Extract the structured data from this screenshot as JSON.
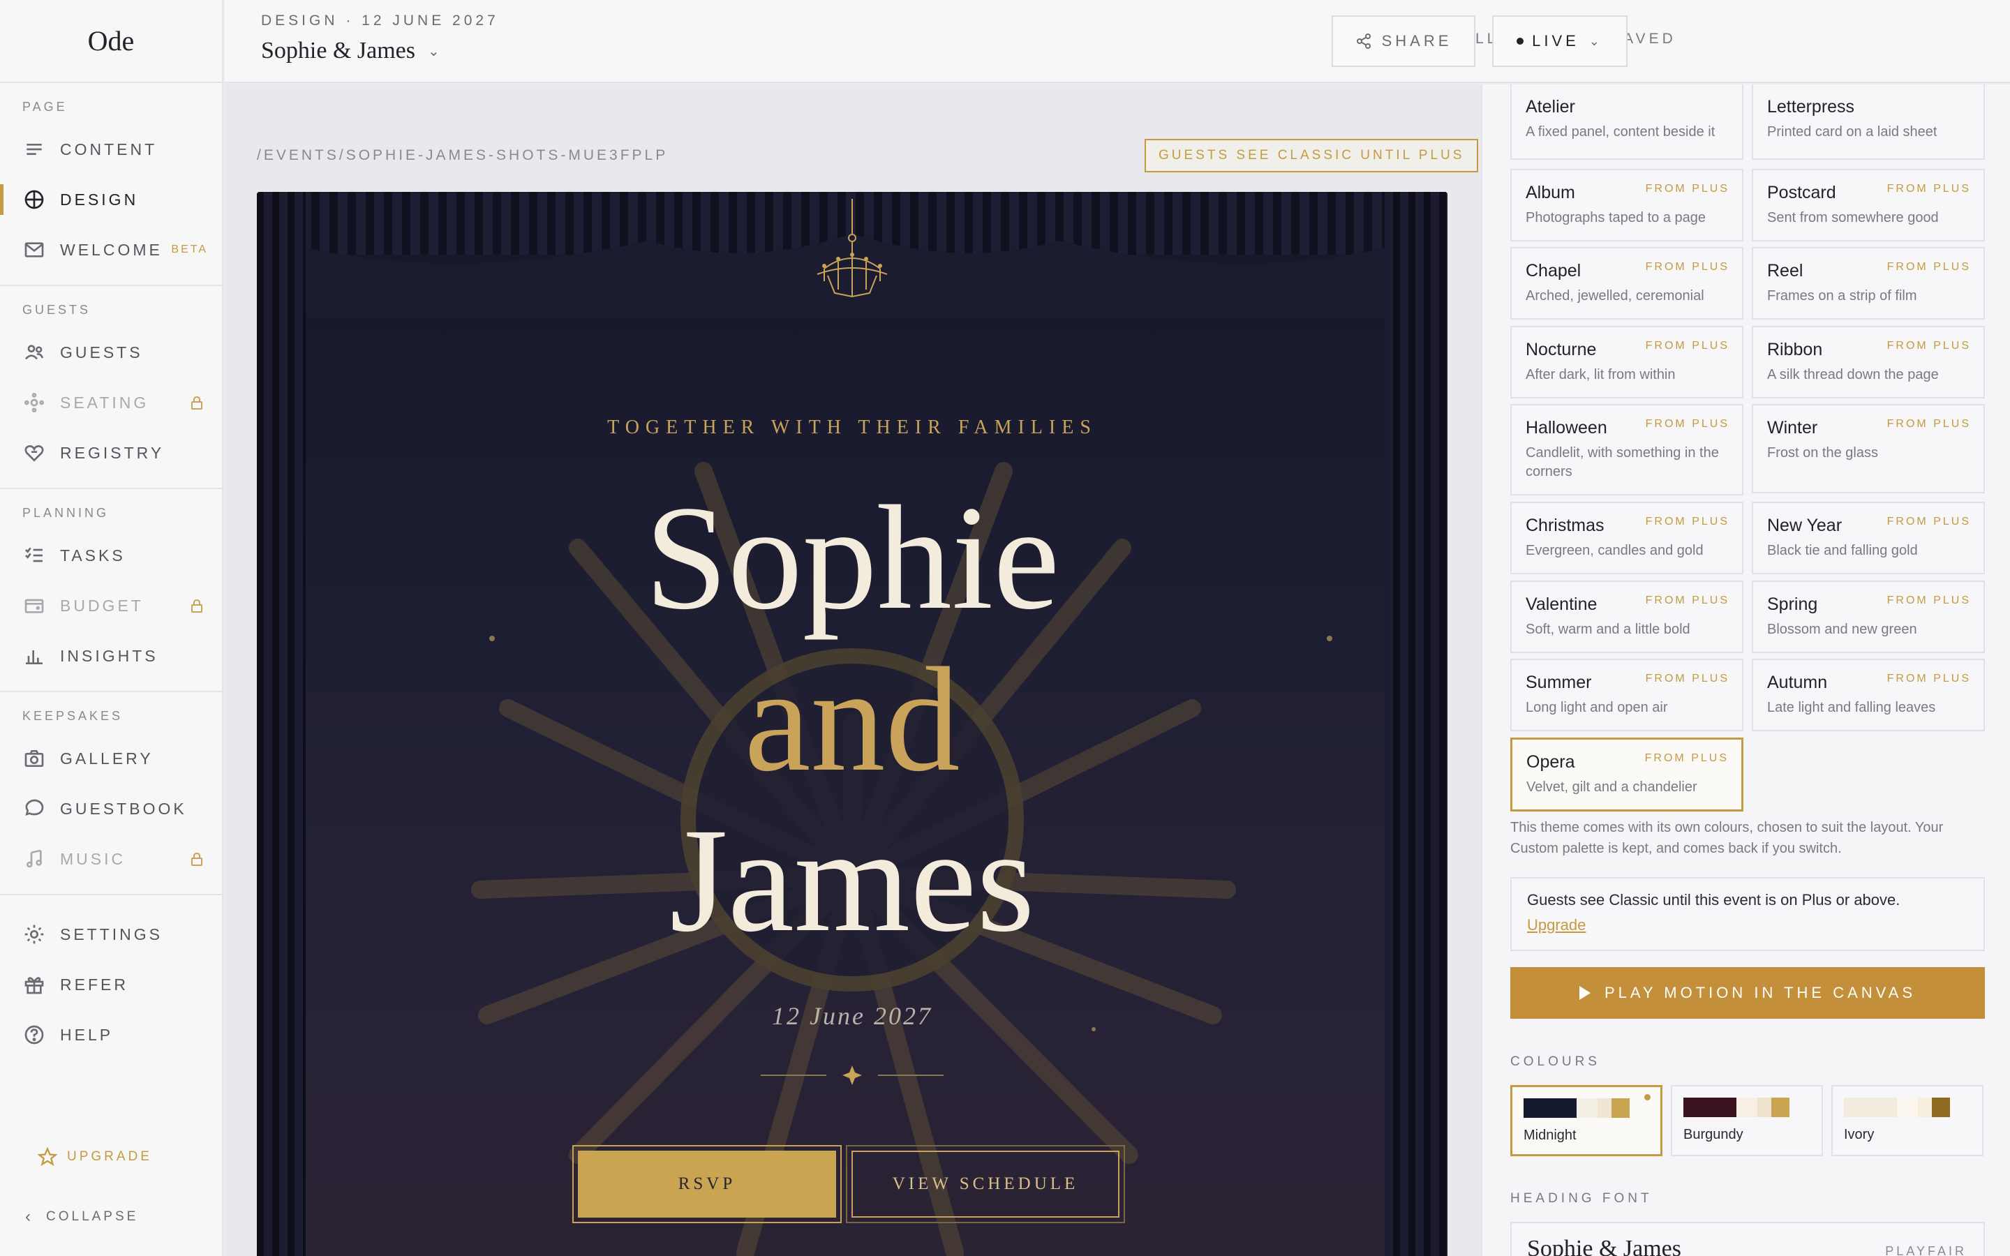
{
  "app": {
    "logo": "Ode"
  },
  "sidebar": {
    "sections": [
      {
        "label": "PAGE",
        "items": [
          {
            "label": "CONTENT",
            "icon": "lines-icon"
          },
          {
            "label": "DESIGN",
            "icon": "compass-icon",
            "active": true
          },
          {
            "label": "WELCOME",
            "icon": "mail-icon",
            "badge": "BETA"
          }
        ]
      },
      {
        "label": "GUESTS",
        "items": [
          {
            "label": "GUESTS",
            "icon": "people-icon"
          },
          {
            "label": "SEATING",
            "icon": "seating-icon",
            "locked": true
          },
          {
            "label": "REGISTRY",
            "icon": "heart-gift-icon"
          }
        ]
      },
      {
        "label": "PLANNING",
        "items": [
          {
            "label": "TASKS",
            "icon": "checklist-icon"
          },
          {
            "label": "BUDGET",
            "icon": "wallet-icon",
            "locked": true
          },
          {
            "label": "INSIGHTS",
            "icon": "bar-chart-icon"
          }
        ]
      },
      {
        "label": "KEEPSAKES",
        "items": [
          {
            "label": "GALLERY",
            "icon": "camera-icon"
          },
          {
            "label": "GUESTBOOK",
            "icon": "speech-bubble-icon"
          },
          {
            "label": "MUSIC",
            "icon": "music-note-icon",
            "locked": true
          }
        ]
      }
    ],
    "bottom_items": [
      {
        "label": "SETTINGS",
        "icon": "gear-icon"
      },
      {
        "label": "REFER",
        "icon": "gift-icon"
      },
      {
        "label": "HELP",
        "icon": "help-icon"
      }
    ],
    "upgrade": "UPGRADE",
    "collapse": "COLLAPSE"
  },
  "header": {
    "crumb": "DESIGN · 12 JUNE 2027",
    "event_title": "Sophie & James",
    "saved": "ALL CHANGES SAVED",
    "share": "SHARE",
    "live": "LIVE"
  },
  "canvas": {
    "url": "/EVENTS/SOPHIE-JAMES-SHOTS-MUE3FPLP",
    "guests_badge": "GUESTS SEE CLASSIC UNTIL PLUS",
    "preview": {
      "together": "TOGETHER WITH THEIR FAMILIES",
      "name1": "Sophie",
      "and": "and",
      "name2": "James",
      "date": "12 June 2027",
      "rsvp": "RSVP",
      "schedule": "VIEW SCHEDULE"
    }
  },
  "panel": {
    "themes": [
      {
        "name": "Atelier",
        "desc": "A fixed panel, content beside it",
        "plus": ""
      },
      {
        "name": "Letterpress",
        "desc": "Printed card on a laid sheet",
        "plus": ""
      },
      {
        "name": "Album",
        "desc": "Photographs taped to a page",
        "plus": "FROM PLUS"
      },
      {
        "name": "Postcard",
        "desc": "Sent from somewhere good",
        "plus": "FROM PLUS"
      },
      {
        "name": "Chapel",
        "desc": "Arched, jewelled, ceremonial",
        "plus": "FROM PLUS"
      },
      {
        "name": "Reel",
        "desc": "Frames on a strip of film",
        "plus": "FROM PLUS"
      },
      {
        "name": "Nocturne",
        "desc": "After dark, lit from within",
        "plus": "FROM PLUS"
      },
      {
        "name": "Ribbon",
        "desc": "A silk thread down the page",
        "plus": "FROM PLUS"
      },
      {
        "name": "Halloween",
        "desc": "Candlelit, with something in the corners",
        "plus": "FROM PLUS"
      },
      {
        "name": "Winter",
        "desc": "Frost on the glass",
        "plus": "FROM PLUS"
      },
      {
        "name": "Christmas",
        "desc": "Evergreen, candles and gold",
        "plus": "FROM PLUS"
      },
      {
        "name": "New Year",
        "desc": "Black tie and falling gold",
        "plus": "FROM PLUS"
      },
      {
        "name": "Valentine",
        "desc": "Soft, warm and a little bold",
        "plus": "FROM PLUS"
      },
      {
        "name": "Spring",
        "desc": "Blossom and new green",
        "plus": "FROM PLUS"
      },
      {
        "name": "Summer",
        "desc": "Long light and open air",
        "plus": "FROM PLUS"
      },
      {
        "name": "Autumn",
        "desc": "Late light and falling leaves",
        "plus": "FROM PLUS"
      },
      {
        "name": "Opera",
        "desc": "Velvet, gilt and a chandelier",
        "plus": "FROM PLUS",
        "selected": true
      }
    ],
    "theme_note": "This theme comes with its own colours, chosen to suit the layout. Your Custom palette is kept, and comes back if you switch.",
    "upgrade_text": "Guests see Classic until this event is on Plus or above.",
    "upgrade_link": "Upgrade",
    "motion_button": "PLAY MOTION IN THE CANVAS",
    "colours_label": "COLOURS",
    "colours": [
      {
        "name": "Midnight",
        "selected": true,
        "swatches": [
          "#151a2e",
          "#151a2e",
          "#f4efe4",
          "#efe6d3",
          "#c9a552"
        ]
      },
      {
        "name": "Burgundy",
        "selected": false,
        "swatches": [
          "#3b1420",
          "#3b1420",
          "#f7efe4",
          "#efe3cf",
          "#c9a552"
        ]
      },
      {
        "name": "Ivory",
        "selected": false,
        "swatches": [
          "#f2ecdf",
          "#f2ecdf",
          "#faf6ee",
          "#f6efe0",
          "#8d6a1f"
        ]
      }
    ],
    "heading_font_label": "HEADING FONT",
    "heading_font_sample": "Sophie & James",
    "heading_font_name": "PLAYFAIR"
  },
  "colors": {
    "accent": "#c49a42",
    "canvas_bg": "#16172a",
    "ivory": "#f3ecdc"
  }
}
